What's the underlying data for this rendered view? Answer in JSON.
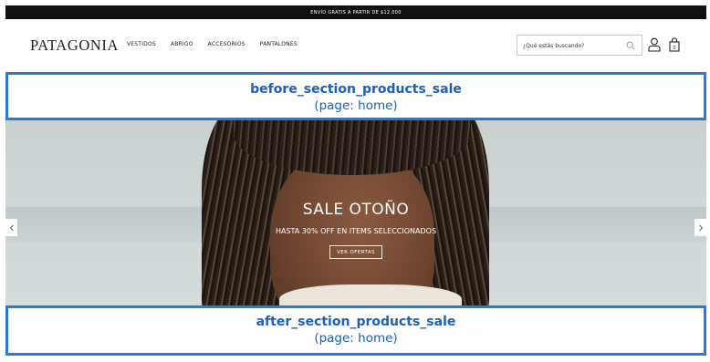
{
  "announcement": {
    "text": "ENVÍO GRATIS A PARTIR DE $12.000"
  },
  "header": {
    "logo": "PATAGONIA",
    "nav": [
      "VESTIDOS",
      "ABRIGO",
      "ACCESORIOS",
      "PANTALONES"
    ],
    "search": {
      "placeholder": "¿Qué estás buscando?",
      "value": ""
    },
    "icons": {
      "search": "search-icon",
      "account": "user-icon",
      "cart": "shopping-bag-icon"
    }
  },
  "hooks": {
    "before": {
      "name": "before_section_products_sale",
      "page": "(page: home)"
    },
    "after": {
      "name": "after_section_products_sale",
      "page": "(page: home)"
    }
  },
  "hero": {
    "title": "SALE OTOÑO",
    "subtitle": "HASTA 30% OFF EN ITEMS SELECCIONADOS",
    "cta": "VER OFERTAS",
    "prev_icon": "chevron-left-icon",
    "next_icon": "chevron-right-icon"
  },
  "colors": {
    "hook_border": "#2a7bd8",
    "hook_text": "#1d5fbf",
    "announce_bg": "#111111"
  }
}
